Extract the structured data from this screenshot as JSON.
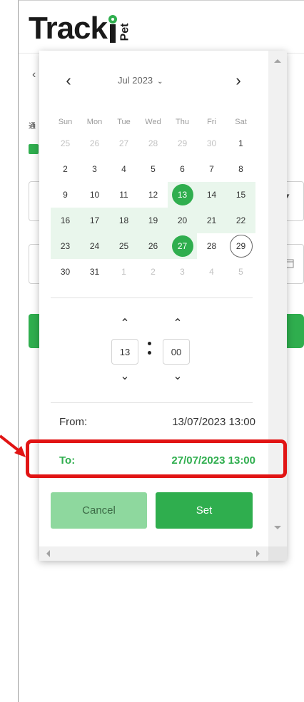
{
  "app": {
    "logo_text": "Track",
    "logo_suffix": "Pet"
  },
  "background": {
    "back_glyph": "‹",
    "checkbox_label": "通",
    "select_caret": "▾",
    "calendar_icon": "calendar-icon"
  },
  "picker": {
    "month_label": "Jul 2023",
    "month_caret": "⌄",
    "prev_label": "‹",
    "next_label": "›",
    "weekdays": [
      "Sun",
      "Mon",
      "Tue",
      "Wed",
      "Thu",
      "Fri",
      "Sat"
    ],
    "weeks": [
      [
        "25",
        "26",
        "27",
        "28",
        "29",
        "30",
        "1"
      ],
      [
        "2",
        "3",
        "4",
        "5",
        "6",
        "7",
        "8"
      ],
      [
        "9",
        "10",
        "11",
        "12",
        "13",
        "14",
        "15"
      ],
      [
        "16",
        "17",
        "18",
        "19",
        "20",
        "21",
        "22"
      ],
      [
        "23",
        "24",
        "25",
        "26",
        "27",
        "28",
        "29"
      ],
      [
        "30",
        "31",
        "1",
        "2",
        "3",
        "4",
        "5"
      ]
    ],
    "range_start_day": "13",
    "range_end_day": "27",
    "today_day": "29",
    "time": {
      "hour": "13",
      "minute": "00",
      "up_glyph": "⌃",
      "down_glyph": "⌄"
    },
    "from_label": "From:",
    "from_value": "13/07/2023 13:00",
    "to_label": "To:",
    "to_value": "27/07/2023 13:00",
    "cancel_label": "Cancel",
    "set_label": "Set"
  },
  "colors": {
    "accent": "#2fae4e",
    "range_fill": "#e9f6ec",
    "cancel_bg": "#8ed89e",
    "annotation": "#e11414"
  }
}
